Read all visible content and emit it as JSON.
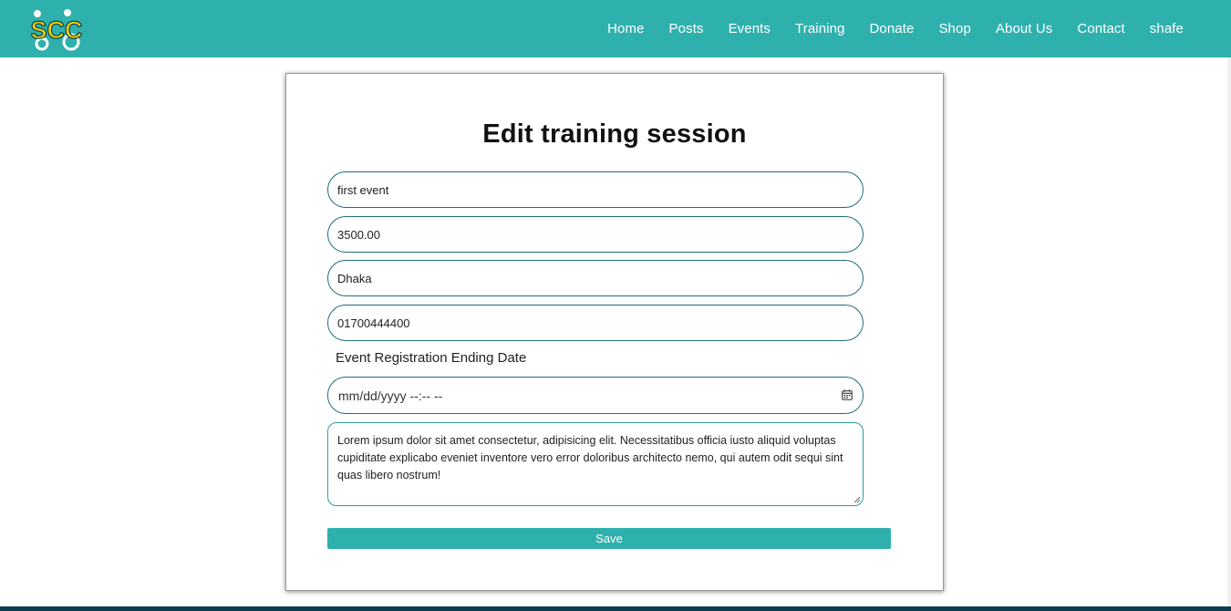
{
  "brand": {
    "logo_text": "SCC",
    "accent_color": "#2eb1ad",
    "logo_color": "#f2d100"
  },
  "nav": {
    "items": [
      {
        "label": "Home"
      },
      {
        "label": "Posts"
      },
      {
        "label": "Events"
      },
      {
        "label": "Training"
      },
      {
        "label": "Donate"
      },
      {
        "label": "Shop"
      },
      {
        "label": "About Us"
      },
      {
        "label": "Contact"
      },
      {
        "label": "shafe"
      }
    ]
  },
  "form": {
    "title": "Edit training session",
    "name_value": "first event",
    "price_value": "3500.00",
    "location_value": "Dhaka",
    "phone_value": "01700444400",
    "date_label": "Event Registration Ending Date",
    "date_placeholder": "mm/dd/yyyy --:-- --",
    "description_value": "Lorem ipsum dolor sit amet consectetur, adipisicing elit. Necessitatibus officia iusto aliquid voluptas cupiditate explicabo eveniet inventore vero error doloribus architecto nemo, qui autem odit sequi sint quas libero nostrum!",
    "save_label": "Save"
  }
}
